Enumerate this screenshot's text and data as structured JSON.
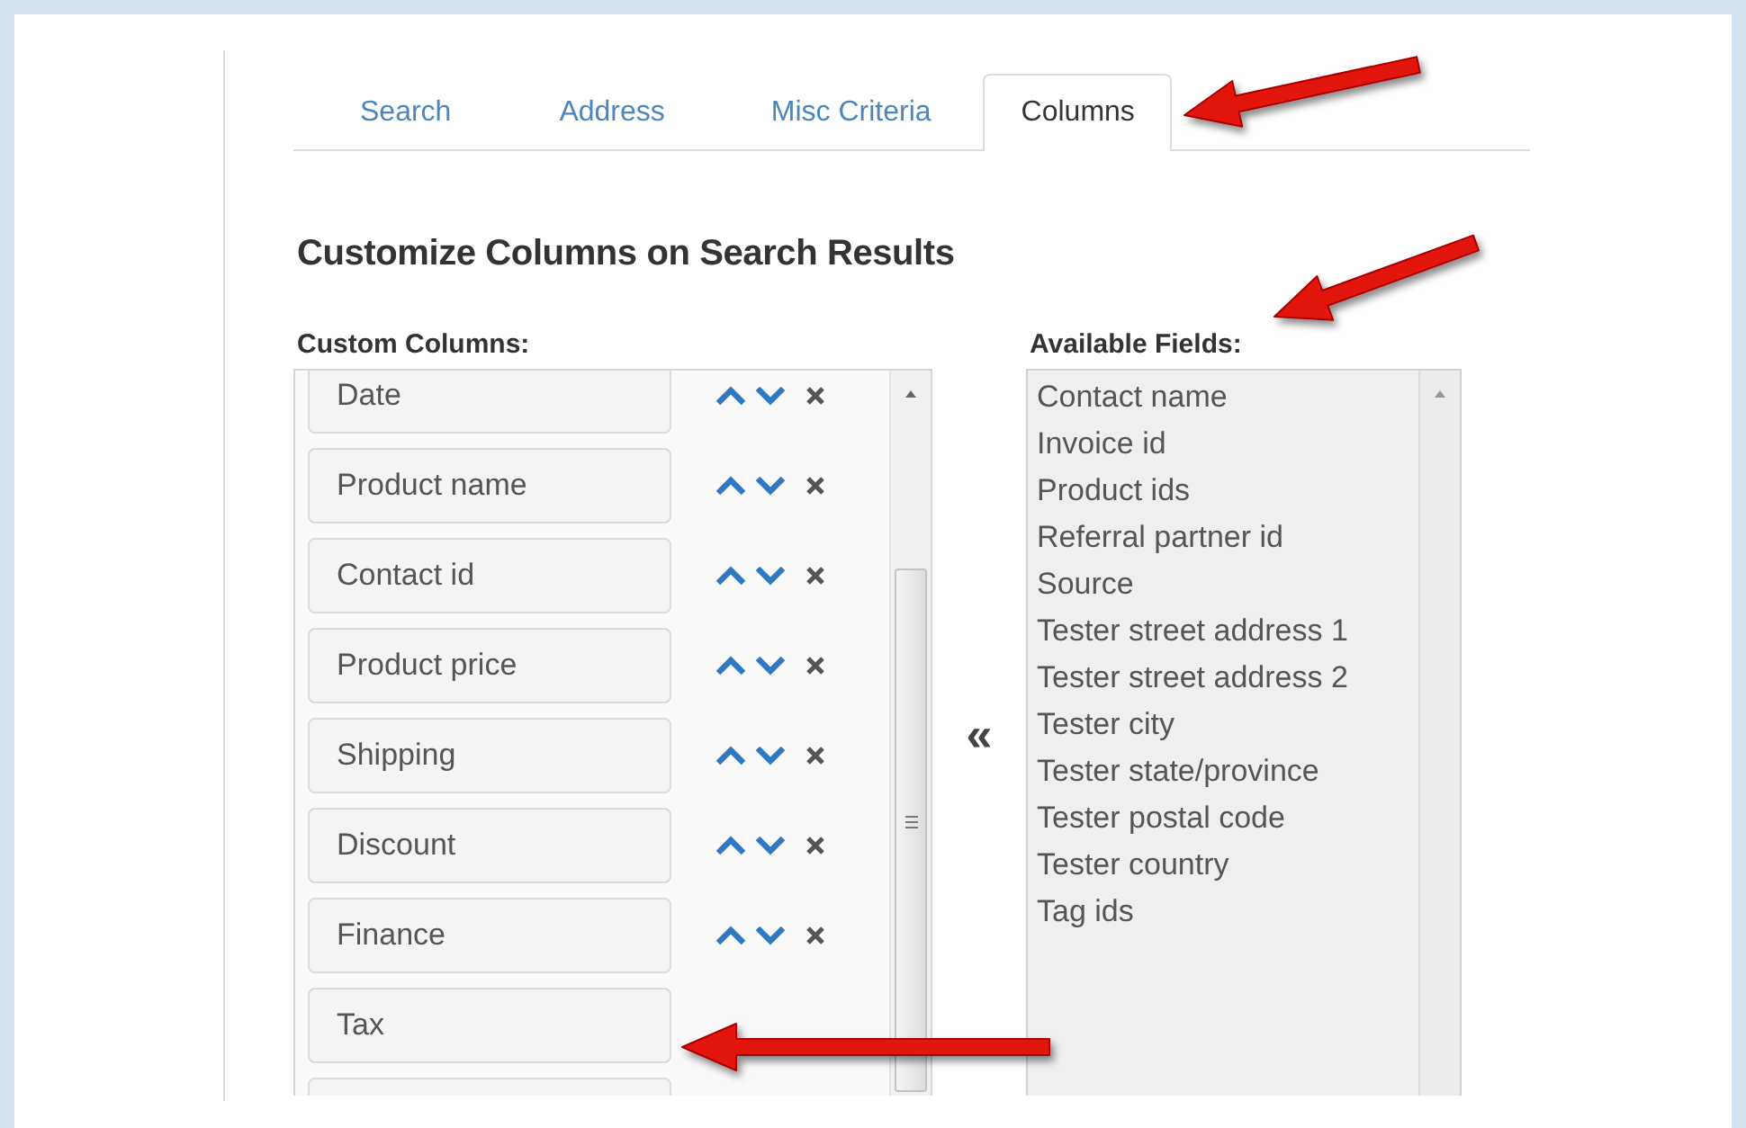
{
  "tabs": [
    {
      "label": "Search",
      "selected": false
    },
    {
      "label": "Address",
      "selected": false
    },
    {
      "label": "Misc Criteria",
      "selected": false
    },
    {
      "label": "Columns",
      "selected": true
    }
  ],
  "heading": "Customize Columns on Search Results",
  "custom_columns": {
    "label": "Custom Columns:",
    "items": [
      "Date",
      "Product name",
      "Contact id",
      "Product price",
      "Shipping",
      "Discount",
      "Finance",
      "Tax"
    ]
  },
  "move_button": "«",
  "available_fields": {
    "label": "Available Fields:",
    "items": [
      "Contact name",
      "Invoice id",
      "Product ids",
      "Referral partner id",
      "Source",
      "Tester street address 1",
      "Tester street address 2",
      "Tester city",
      "Tester state/province",
      "Tester postal code",
      "Tester country",
      "Tag ids"
    ]
  }
}
